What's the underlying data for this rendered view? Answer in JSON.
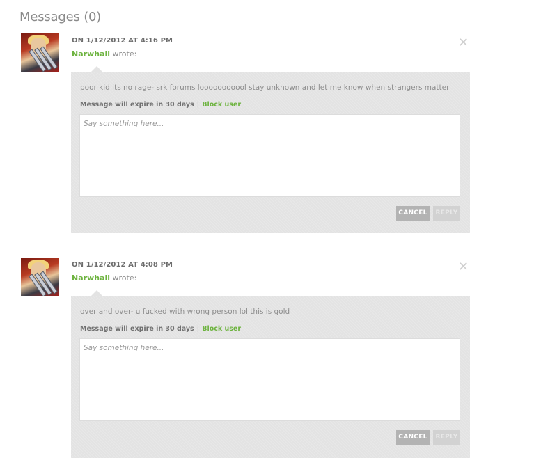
{
  "heading": "Messages (0)",
  "messages": [
    {
      "date": "ON 1/12/2012 AT 4:16 PM",
      "author": "Narwhall",
      "wrote": " wrote:",
      "body": "poor kid its no rage- srk forums looooooooool stay unknown and let me know when strangers matter",
      "expire": "Message will expire in 30 days",
      "separator": "|",
      "block": "Block user",
      "placeholder": "Say something here...",
      "cancel": "CANCEL",
      "reply": "REPLY",
      "close": "✕"
    },
    {
      "date": "ON 1/12/2012 AT 4:08 PM",
      "author": "Narwhall",
      "wrote": " wrote:",
      "body": "over and over- u fucked with wrong person lol this is gold",
      "expire": "Message will expire in 30 days",
      "separator": "|",
      "block": "Block user",
      "placeholder": "Say something here...",
      "cancel": "CANCEL",
      "reply": "REPLY",
      "close": "✕"
    }
  ],
  "colors": {
    "accent_green": "#6db33f",
    "bubble_bg": "#e3e3e3",
    "cancel_bg": "#b3b3b3",
    "reply_bg": "#d2d2d2"
  },
  "icons": {
    "close": "close-icon",
    "avatar": "user-avatar-image"
  }
}
